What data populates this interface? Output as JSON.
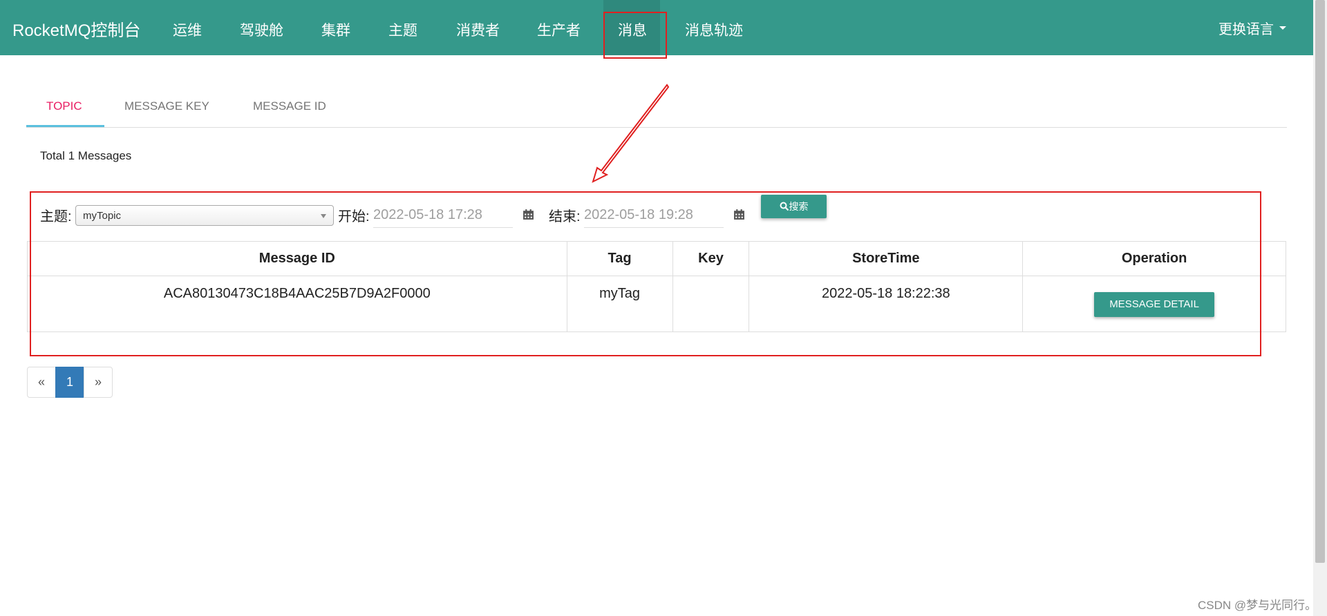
{
  "navbar": {
    "brand": "RocketMQ控制台",
    "items": [
      "运维",
      "驾驶舱",
      "集群",
      "主题",
      "消费者",
      "生产者",
      "消息",
      "消息轨迹"
    ],
    "active": "消息",
    "language": "更换语言"
  },
  "tabs": {
    "items": [
      "TOPIC",
      "MESSAGE KEY",
      "MESSAGE ID"
    ],
    "active": "TOPIC"
  },
  "summary": {
    "total": "Total 1 Messages"
  },
  "search": {
    "topic_label": "主题:",
    "topic_value": "myTopic",
    "start_label": "开始:",
    "start_value": "2022-05-18 17:28",
    "end_label": "结束:",
    "end_value": "2022-05-18 19:28",
    "search_button": "搜索"
  },
  "table": {
    "headers": [
      "Message ID",
      "Tag",
      "Key",
      "StoreTime",
      "Operation"
    ],
    "rows": [
      {
        "message_id": "ACA80130473C18B4AAC25B7D9A2F0000",
        "tag": "myTag",
        "key": "",
        "store_time": "2022-05-18 18:22:38",
        "operation": "MESSAGE DETAIL"
      }
    ]
  },
  "pagination": {
    "prev": "«",
    "current": "1",
    "next": "»"
  },
  "watermark": "CSDN @梦与光同行。",
  "colors": {
    "navbar": "#35998b",
    "active_tab": "#e91e63",
    "tab_underline": "#5bc0de",
    "page_current": "#337ab7",
    "annotation": "#e02020"
  }
}
